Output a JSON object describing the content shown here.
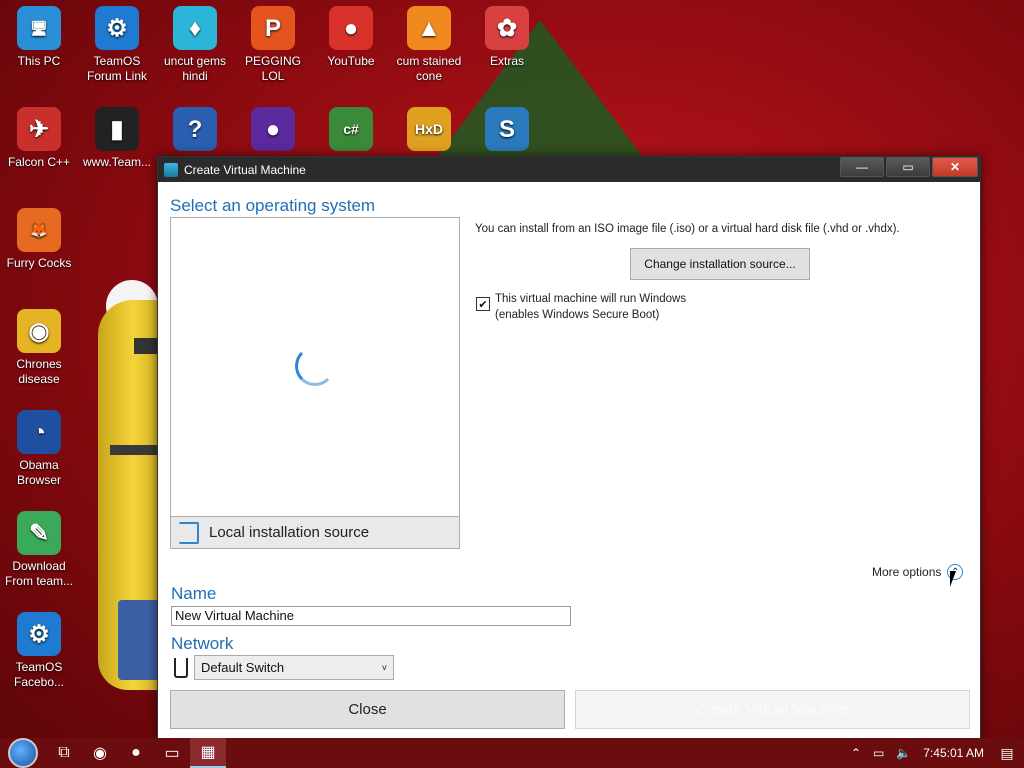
{
  "desktop_icons": [
    {
      "label": "This PC",
      "icon": "monitor-icon",
      "color": "#2a8fd6",
      "glyph": "🖥"
    },
    {
      "label": "TeamOS Forum Link",
      "icon": "gear-icon",
      "color": "#1f7ad1",
      "glyph": "⚙"
    },
    {
      "label": "uncut gems hindi",
      "icon": "diamond-icon",
      "color": "#2bb6d9",
      "glyph": "♦"
    },
    {
      "label": "PEGGING LOL",
      "icon": "p-logo-icon",
      "color": "#e5531f",
      "glyph": "P"
    },
    {
      "label": "YouTube",
      "icon": "angry-bird-icon",
      "color": "#d9322b",
      "glyph": "●"
    },
    {
      "label": "cum stained cone",
      "icon": "vlc-cone-icon",
      "color": "#f08a1f",
      "glyph": "▲"
    },
    {
      "label": "Extras",
      "icon": "extras-icon",
      "color": "#d94040",
      "glyph": "✿"
    },
    {
      "label": "Falcon C++",
      "icon": "falcon-icon",
      "color": "#c9302c",
      "glyph": "✈"
    },
    {
      "label": "www.Team...",
      "icon": "document-icon",
      "color": "#222222",
      "glyph": "▮"
    },
    {
      "label": "",
      "icon": "question-icon",
      "color": "#2a5fb0",
      "glyph": "?"
    },
    {
      "label": "",
      "icon": "ball-icon",
      "color": "#5a2a9e",
      "glyph": "●"
    },
    {
      "label": "",
      "icon": "csharp-icon",
      "color": "#3a8a3a",
      "glyph": "c#"
    },
    {
      "label": "",
      "icon": "hxd-icon",
      "color": "#e0a020",
      "glyph": "HxD"
    },
    {
      "label": "",
      "icon": "s-icon",
      "color": "#2a7abd",
      "glyph": "S"
    },
    {
      "label": "Furry Cocks",
      "icon": "firefox-icon",
      "color": "#e66a1f",
      "glyph": "🦊"
    },
    {
      "label": "Chrones disease",
      "icon": "chrome-icon",
      "color": "#e4b424",
      "glyph": "◉"
    },
    {
      "label": "Obama Browser",
      "icon": "obama-logo-icon",
      "color": "#1f4fa0",
      "glyph": "◔"
    },
    {
      "label": "Download From team...",
      "icon": "notepad-icon",
      "color": "#3aaa5a",
      "glyph": "✎"
    },
    {
      "label": "TeamOS Facebo...",
      "icon": "gear-icon",
      "color": "#1f7ad1",
      "glyph": "⚙"
    }
  ],
  "window": {
    "title": "Create Virtual Machine",
    "controls": {
      "minimize": "—",
      "maximize": "▭",
      "close": "✕"
    },
    "os_section_title": "Select an operating system",
    "local_source_label": "Local installation source",
    "install_info": "You can install from an ISO image file (.iso) or a virtual hard disk file (.vhd or .vhdx).",
    "change_source_label": "Change installation source...",
    "windows_checkbox": {
      "checked": true,
      "line1": "This virtual machine will run Windows",
      "line2": "(enables Windows Secure Boot)"
    },
    "more_options_label": "More options",
    "name_label": "Name",
    "name_value": "New Virtual Machine",
    "network_label": "Network",
    "network_value": "Default Switch",
    "close_label": "Close",
    "create_label": "Create Virtual Machine"
  },
  "taskbar": {
    "items": [
      "start-button",
      "task-view-icon",
      "chrome-icon",
      "firefox-icon",
      "file-explorer-icon",
      "quick-create-icon"
    ],
    "clock": "7:45:01 AM"
  },
  "colors": {
    "accent": "#1f6fb5",
    "desktop_bg": "#b01218",
    "taskbar_bg": "#6b0c0f"
  }
}
